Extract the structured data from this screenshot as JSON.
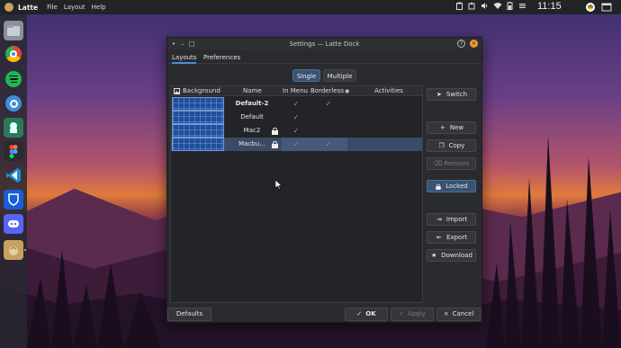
{
  "top_panel": {
    "app_name": "Latte",
    "menus": [
      "File",
      "Layout",
      "Help"
    ],
    "clock": "11:15"
  },
  "dialog": {
    "title": "Settings — Latte Dock",
    "tabs": [
      "Layouts",
      "Preferences"
    ],
    "mode": {
      "single": "Single",
      "multiple": "Multiple",
      "selected": "Single"
    },
    "columns": {
      "background": "Background",
      "name": "Name",
      "in_menu": "In Menu",
      "borderless": "Borderless",
      "activities": "Activities"
    },
    "layouts": [
      {
        "name": "Default-2",
        "bold": true,
        "locked": false,
        "in_menu": true,
        "borderless": true,
        "selected": false
      },
      {
        "name": "Default",
        "bold": false,
        "locked": false,
        "in_menu": true,
        "borderless": false,
        "selected": false
      },
      {
        "name": "Mac2",
        "bold": false,
        "locked": true,
        "in_menu": true,
        "borderless": false,
        "selected": false
      },
      {
        "name": "Macbu...",
        "bold": false,
        "locked": true,
        "in_menu": true,
        "borderless": true,
        "selected": true
      }
    ],
    "side_buttons": {
      "switch": "Switch",
      "new": "New",
      "copy": "Copy",
      "remove": "Remove",
      "locked": "Locked",
      "import": "Import",
      "export": "Export",
      "download": "Download"
    },
    "footer": {
      "defaults": "Defaults",
      "ok": "OK",
      "apply": "Apply",
      "cancel": "Cancel"
    }
  }
}
